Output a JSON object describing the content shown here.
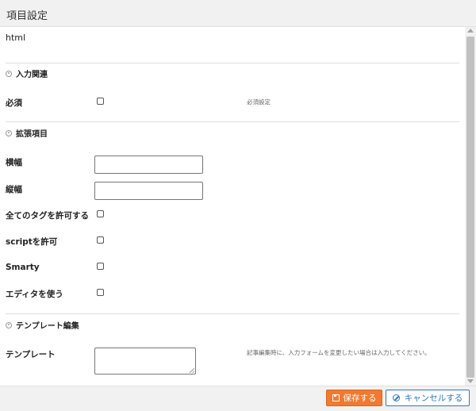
{
  "dialog": {
    "title": "項目設定"
  },
  "field": {
    "name": "html"
  },
  "sections": {
    "input": "入力関連",
    "extended": "拡張項目",
    "template": "テンプレート編集"
  },
  "rows": {
    "required": {
      "label": "必須",
      "hint": "必須設定"
    },
    "width": {
      "label": "横幅"
    },
    "height": {
      "label": "縦幅"
    },
    "allow_all_tags": {
      "label": "全てのタグを許可する"
    },
    "allow_script": {
      "label": "scriptを許可"
    },
    "smarty": {
      "label": "Smarty"
    },
    "use_editor": {
      "label": "エディタを使う"
    },
    "template": {
      "label": "テンプレート",
      "hint": "記事編集時に、入力フォームを変更したい場合は入力してください。"
    }
  },
  "footer": {
    "save_label": "保存する",
    "cancel_label": "キャンセルする"
  },
  "colors": {
    "save": "#f07a2f",
    "cancel": "#2d76c9"
  }
}
